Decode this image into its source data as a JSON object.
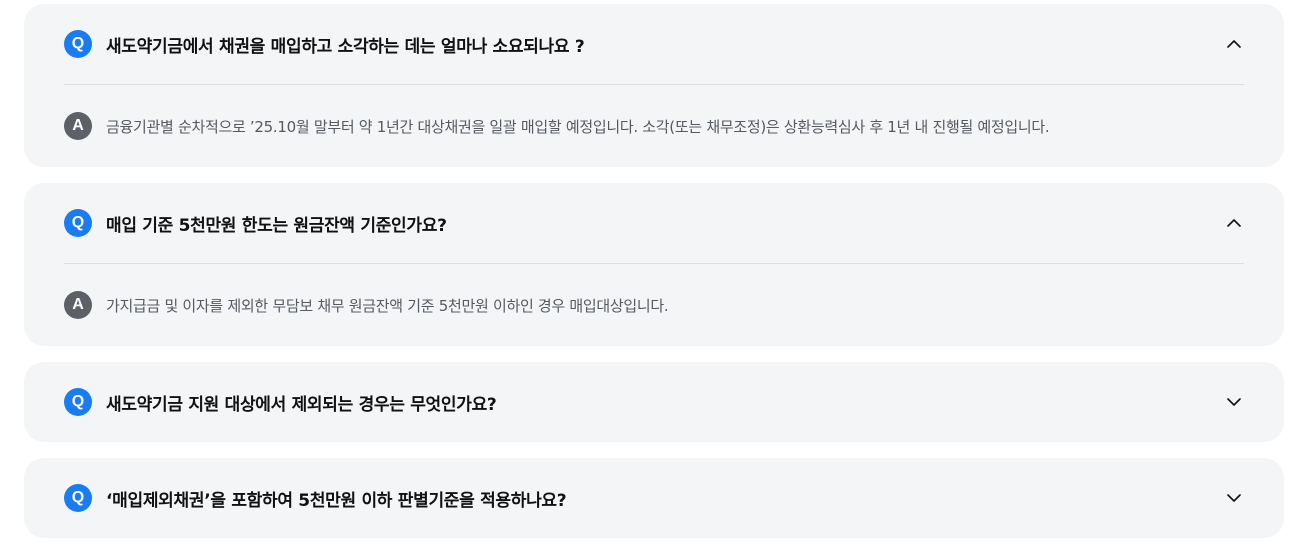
{
  "badges": {
    "question": "Q",
    "answer": "A"
  },
  "colors": {
    "accent": "#1a7cf5",
    "answer_badge": "#5d6066",
    "card_bg": "#f4f5f7"
  },
  "faq": [
    {
      "question": "새도약기금에서 채권을 매입하고 소각하는 데는 얼마나 소요되나요 ?",
      "answer": "금융기관별 순차적으로 ’25.10월 말부터 약 1년간 대상채권을 일괄 매입할 예정입니다. 소각(또는 채무조정)은 상환능력심사 후 1년 내 진행될 예정입니다.",
      "expanded": true,
      "toggle_icon": "chevron-up-icon"
    },
    {
      "question": "매입 기준 5천만원 한도는 원금잔액 기준인가요?",
      "answer": "가지급금 및 이자를 제외한 무담보 채무 원금잔액 기준 5천만원 이하인 경우 매입대상입니다.",
      "expanded": true,
      "toggle_icon": "chevron-up-icon"
    },
    {
      "question": "새도약기금 지원 대상에서 제외되는 경우는 무엇인가요?",
      "expanded": false,
      "toggle_icon": "chevron-down-icon"
    },
    {
      "question": "‘매입제외채권’을 포함하여 5천만원 이하 판별기준을 적용하나요?",
      "expanded": false,
      "toggle_icon": "chevron-down-icon"
    }
  ]
}
